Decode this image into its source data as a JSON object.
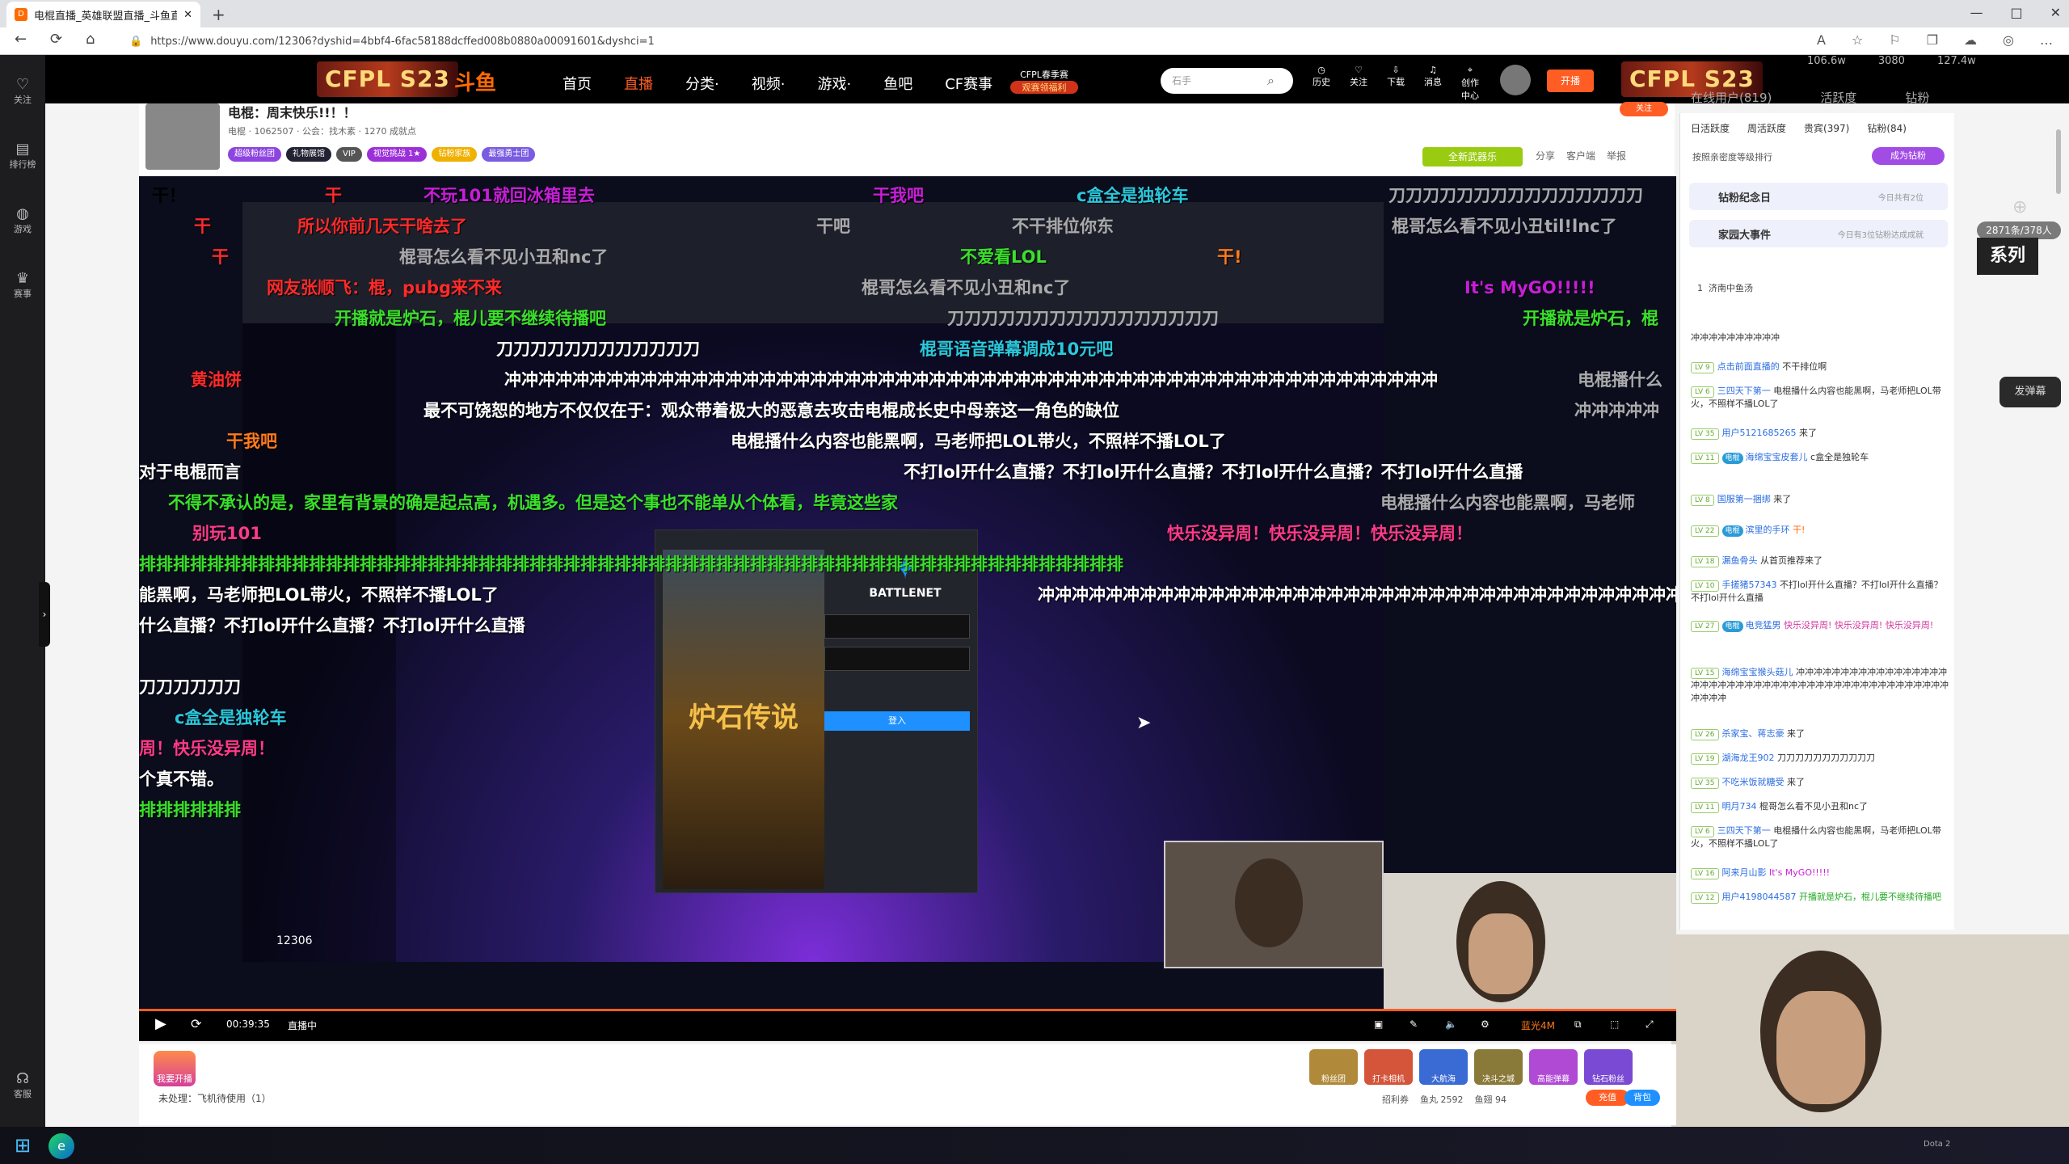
{
  "browser": {
    "tab_title": "电棍直播_英雄联盟直播_斗鱼直播",
    "new_tab": "+",
    "url": "https://www.douyu.com/12306?dyshid=4bbf4-6fac58188dcffed008b0880a00091601&dyshci=1",
    "window_controls": [
      "—",
      "□",
      "✕"
    ],
    "nav": [
      "←",
      "⟳",
      "⌂"
    ],
    "tools": [
      "A",
      "☆",
      "⚐",
      "❐",
      "☁",
      "◎",
      "…"
    ]
  },
  "header": {
    "left_logo": "CFPL S23",
    "douyu_logo": "斗鱼",
    "menu": [
      "首页",
      "直播",
      "分类·",
      "视频·",
      "游戏·",
      "鱼吧",
      "CF赛事"
    ],
    "banner_line1": "CFPL春季赛",
    "banner_line2": "观赛领福利",
    "search_placeholder": "石手",
    "icons": [
      "历史",
      "关注",
      "下载",
      "消息",
      "创作中心"
    ],
    "open_live": "开播",
    "right_logo": "CFPL S23",
    "stats": [
      "106.6w",
      "3080",
      "127.4w"
    ],
    "online_users": "在线用户(819)",
    "activity": "活跃度",
    "vip": "钻粉"
  },
  "left_nav": [
    "关注",
    "排行榜",
    "游戏",
    "赛事",
    "客服"
  ],
  "streamer": {
    "name": "电棍：周末快乐!!！！",
    "meta": "电棍 · 1062507 · 公会：找木素 · 1270 成就点",
    "badges": [
      "超级粉丝团",
      "礼物展馆",
      "VIP",
      "视觉挑战 1★",
      "钻粉家族",
      "最强勇士团"
    ],
    "activity_banner": "全新武器乐",
    "actions": [
      "分享",
      "客户端",
      "举报"
    ],
    "follow": "关注"
  },
  "danmaku": [
    {
      "t": "干！",
      "c": "g"
    },
    {
      "t": "干",
      "c": "r"
    },
    {
      "t": "不玩101就回冰箱里去",
      "c": "p"
    },
    {
      "t": "干我吧",
      "c": "p"
    },
    {
      "t": "c盒全是独轮车",
      "c": "c"
    },
    {
      "t": "刀刀刀刀刀刀刀刀刀刀刀刀刀刀刀",
      "c": "gr"
    },
    {
      "t": "干",
      "c": "r"
    },
    {
      "t": "所以你前几天干啥去了",
      "c": "r"
    },
    {
      "t": "干吧",
      "c": "gr"
    },
    {
      "t": "不干排位你东",
      "c": "gr"
    },
    {
      "t": "棍哥怎么看不见小丑til!lnc了",
      "c": "gr"
    },
    {
      "t": "干",
      "c": "r"
    },
    {
      "t": "棍哥怎么看不见小丑和nc了",
      "c": "gr"
    },
    {
      "t": "不爱看LOL",
      "c": "g"
    },
    {
      "t": "干!",
      "c": "or"
    },
    {
      "t": "网友张顺飞：棍，pubg来不来",
      "c": "r"
    },
    {
      "t": "棍哥怎么看不见小丑和nc了",
      "c": "gr"
    },
    {
      "t": "It's MyGO!!!!!",
      "c": "p"
    },
    {
      "t": "开播就是炉石，棍儿要不继续待播吧",
      "c": "g"
    },
    {
      "t": "刀刀刀刀刀刀刀刀刀刀刀刀刀刀刀刀",
      "c": "gr"
    },
    {
      "t": "开播就是炉石，棍",
      "c": "g"
    },
    {
      "t": "刀刀刀刀刀刀刀刀刀刀刀刀",
      "c": "w"
    },
    {
      "t": "棍哥语音弹幕调成10元吧",
      "c": "c"
    },
    {
      "t": "黄油饼",
      "c": "r"
    },
    {
      "t": "冲冲冲冲冲冲冲冲冲冲冲冲冲冲冲冲冲冲冲冲冲冲冲冲冲冲冲冲冲冲冲冲冲冲冲冲冲冲冲冲冲冲冲冲冲冲冲冲冲冲冲冲冲冲冲",
      "c": "w"
    },
    {
      "t": "电棍播什么",
      "c": "gr"
    },
    {
      "t": "最不可饶恕的地方不仅仅在于：观众带着极大的恶意去攻击电棍成长史中母亲这一角色的缺位",
      "c": "w"
    },
    {
      "t": "冲冲冲冲冲",
      "c": "gr"
    },
    {
      "t": "干我吧",
      "c": "or"
    },
    {
      "t": "电棍播什么内容也能黑啊，马老师把LOL带火，不照样不播LOL了",
      "c": "w"
    },
    {
      "t": "对于电棍而言",
      "c": "w"
    },
    {
      "t": "不打lol开什么直播？不打lol开什么直播？不打lol开什么直播？不打lol开什么直播",
      "c": "w"
    },
    {
      "t": "不得不承认的是，家里有背景的确是起点高，机遇多。但是这个事也不能单从个体看，毕竟这些家",
      "c": "g"
    },
    {
      "t": "电棍播什么内容也能黑啊，马老师",
      "c": "gr"
    },
    {
      "t": "别玩101",
      "c": "pk"
    },
    {
      "t": "快乐没异周！快乐没异周！快乐没异周！",
      "c": "pk"
    },
    {
      "t": "排排排排排排排排排排排排排排排排排排排排排排排排排排排排排排排排排排排排排排排排排排排排排排排排排排排排排排排排排排",
      "c": "g"
    },
    {
      "t": "能黑啊，马老师把LOL带火，不照样不播LOL了",
      "c": "w"
    },
    {
      "t": "冲冲冲冲冲冲冲冲冲冲冲冲冲冲冲冲冲冲冲冲冲冲冲冲冲冲冲冲冲冲冲冲冲冲冲冲冲冲冲冲冲",
      "c": "w"
    },
    {
      "t": "什么直播？不打lol开什么直播？不打lol开什么直播",
      "c": "w"
    },
    {
      "t": "刀刀刀刀刀刀",
      "c": "w"
    },
    {
      "t": "c盒全是独轮车",
      "c": "c"
    },
    {
      "t": "周！快乐没异周！",
      "c": "pk"
    },
    {
      "t": "个真不错。",
      "c": "w"
    },
    {
      "t": "排排排排排排",
      "c": "g"
    }
  ],
  "game": {
    "launcher_brand": "BATTLENET",
    "game_title": "炉石传说",
    "login_button": "登入",
    "room_no": "12306"
  },
  "player": {
    "time": "00:39:35",
    "status": "直播中",
    "quality": "蓝光4M"
  },
  "gift_bar": {
    "enter_label": "我要开播",
    "unprocessed": "未处理：飞机待使用（1）",
    "gifts": [
      "粉丝团",
      "打卡相机",
      "大航海",
      "决斗之城",
      "高能弹幕",
      "钻石粉丝"
    ],
    "fish_stats": [
      "招利券",
      "鱼丸 2592",
      "鱼翅 94"
    ],
    "recharge": "充值",
    "bag": "背包"
  },
  "right_panel": {
    "tabs": [
      "日活跃度",
      "周活跃度",
      "贵宾(397)",
      "钻粉(84)"
    ],
    "sort_text": "按照亲密度等级排行",
    "boost_btn": "成为钻粉",
    "cards": [
      {
        "title": "钻粉纪念日",
        "sub": "今日共有2位"
      },
      {
        "title": "家园大事件",
        "sub": "今日有3位钻粉达成成就"
      }
    ],
    "rank1": "济南中鱼汤",
    "online_count": "2871条/378人",
    "series": "系列",
    "send_danmaku": "发弹幕",
    "collapse": "›"
  },
  "chat": [
    {
      "lv": "",
      "user": "",
      "text": "冲冲冲冲冲冲冲冲冲冲"
    },
    {
      "lv": "LV 9",
      "user": "点击前面直播的",
      "text": "不干排位啊"
    },
    {
      "lv": "LV 6",
      "user": "三四天下第一",
      "text": "电棍播什么内容也能黑啊，马老师把LOL带火，不照样不播LOL了"
    },
    {
      "lv": "LV 35",
      "user": "用户5121685265",
      "text": "来了"
    },
    {
      "lv": "LV 11",
      "user": "海绵宝宝皮套儿",
      "text": "c盒全是独轮车"
    },
    {
      "lv": "LV 8",
      "user": "国服第一捆绑",
      "text": "来了"
    },
    {
      "lv": "LV 22",
      "user": "滨里的手环",
      "text": "干!"
    },
    {
      "lv": "LV 18",
      "user": "漏鱼骨头",
      "text": "从首页推荐来了"
    },
    {
      "lv": "LV 10",
      "user": "手搓猪57343",
      "text": "不打lol开什么直播？不打lol开什么直播？不打lol开什么直播"
    },
    {
      "lv": "LV 27",
      "user": "电竞猛男",
      "text": "快乐没异周! 快乐没异周! 快乐没异周!"
    },
    {
      "lv": "LV 15",
      "user": "海绵宝宝猴头菇儿",
      "text": "冲冲冲冲冲冲冲冲冲冲冲冲冲冲冲冲冲冲冲冲冲冲冲冲冲冲冲冲冲冲冲冲冲冲冲冲冲冲冲冲冲冲冲冲冲冲冲冲冲冲"
    },
    {
      "lv": "LV 26",
      "user": "杀家宝、蒋志豪",
      "text": "来了"
    },
    {
      "lv": "LV 19",
      "user": "湖海龙王902",
      "text": "刀刀刀刀刀刀刀刀刀刀刀"
    },
    {
      "lv": "LV 35",
      "user": "不吃米饭就糖受",
      "text": "来了"
    },
    {
      "lv": "LV 11",
      "user": "明月734",
      "text": "棍哥怎么看不见小丑和nc了"
    },
    {
      "lv": "LV 6",
      "user": "三四天下第一",
      "text": "电棍播什么内容也能黑啊，马老师把LOL带火，不照样不播LOL了"
    },
    {
      "lv": "LV 16",
      "user": "阿来月山影",
      "text": "It's MyGO!!!!!"
    },
    {
      "lv": "LV 12",
      "user": "用户4198044587",
      "text": "开播就是炉石，棍儿要不继续待播吧"
    }
  ],
  "taskbar": {
    "start": "⊞",
    "browser": "e",
    "tray": "Dota 2"
  }
}
